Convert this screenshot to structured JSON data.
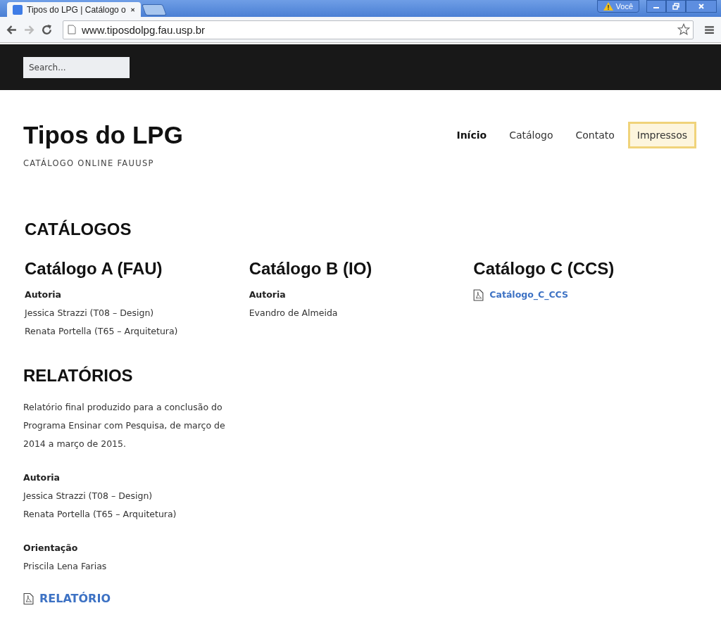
{
  "browser": {
    "tabs": [
      {
        "title": "Tipos do LPG | Catálogo o",
        "selected": true
      }
    ],
    "profile": "Você",
    "address": "www.tiposdolpg.fau.usp.br"
  },
  "search": {
    "placeholder": "Search..."
  },
  "site": {
    "title": "Tipos do LPG",
    "tagline": "CATÁLOGO ONLINE FAUUSP"
  },
  "nav": [
    {
      "label": "Início",
      "selected": true,
      "highlighted": false
    },
    {
      "label": "Catálogo",
      "selected": false,
      "highlighted": false
    },
    {
      "label": "Contato",
      "selected": false,
      "highlighted": false
    },
    {
      "label": "Impressos",
      "selected": false,
      "highlighted": true
    }
  ],
  "catalogs": {
    "heading": "CATÁLOGOS",
    "columns": [
      {
        "title": "Catálogo A (FAU)",
        "label": "Autoria",
        "people": [
          "Jessica Strazzi (T08 – Design)",
          "Renata Portella (T65 – Arquitetura)"
        ]
      },
      {
        "title": "Catálogo B (IO)",
        "label": "Autoria",
        "people": [
          "Evandro de Almeida"
        ]
      },
      {
        "title": "Catálogo C (CCS)",
        "file": "Catálogo_C_CCS"
      }
    ]
  },
  "reports": {
    "heading": "RELATÓRIOS",
    "description": "Relatório final produzido para a conclusão do Programa Ensinar com Pesquisa, de março de 2014 a março de 2015.",
    "groups": [
      {
        "label": "Autoria",
        "people": [
          "Jessica Strazzi (T08 – Design)",
          "Renata Portella (T65 – Arquitetura)"
        ]
      },
      {
        "label": "Orientação",
        "people": [
          "Priscila Lena Farias"
        ]
      }
    ],
    "file": "RELATÓRIO"
  }
}
